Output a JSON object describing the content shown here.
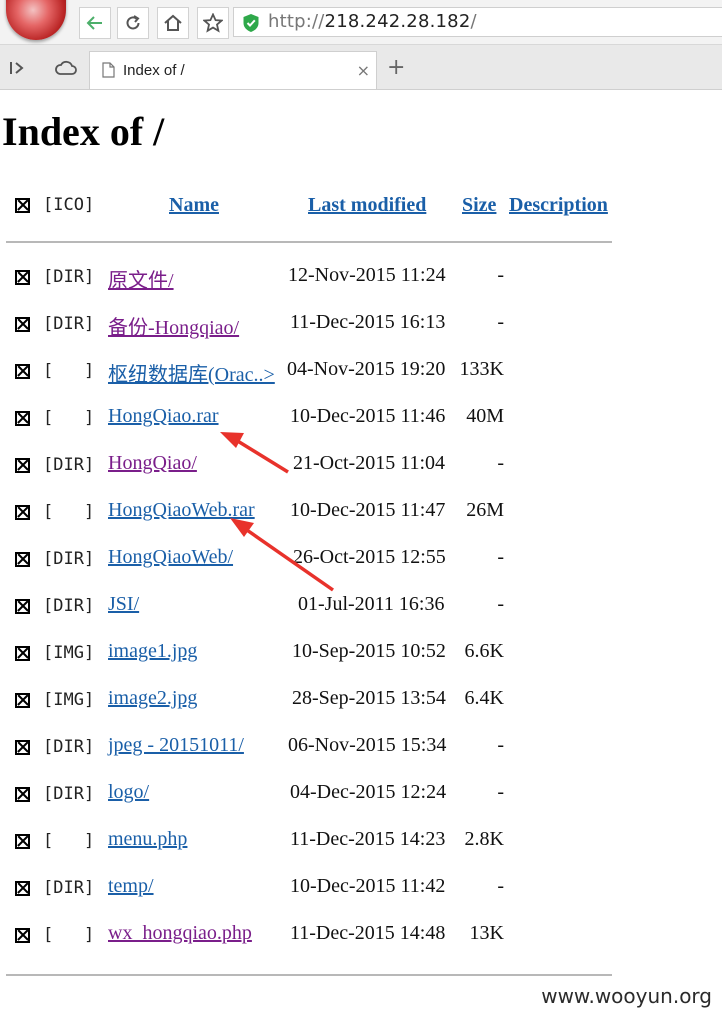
{
  "browser": {
    "url_scheme": "http://",
    "url_host": "218.242.28.182",
    "url_path": "/",
    "tab_title": "Index of /",
    "tab_close": "×",
    "new_tab": "+"
  },
  "page": {
    "title": "Index of /",
    "header_alt": "[ICO]",
    "columns": {
      "name": "Name",
      "last_modified": "Last modified",
      "size": "Size",
      "description": "Description"
    },
    "rows": [
      {
        "alt": "[DIR]",
        "name": "原文件/",
        "date": "12-Nov-2015 11:24",
        "size": "-",
        "visited": true
      },
      {
        "alt": "[DIR]",
        "name": "备份-Hongqiao/",
        "date": "11-Dec-2015 16:13",
        "size": "-",
        "visited": true
      },
      {
        "alt": "[   ]",
        "name": "枢纽数据库(Orac..>",
        "date": "04-Nov-2015 19:20",
        "size": "133K",
        "visited": false
      },
      {
        "alt": "[   ]",
        "name": "HongQiao.rar",
        "date": "10-Dec-2015 11:46",
        "size": "40M",
        "visited": false
      },
      {
        "alt": "[DIR]",
        "name": "HongQiao/",
        "date": "21-Oct-2015 11:04",
        "size": "-",
        "visited": true
      },
      {
        "alt": "[   ]",
        "name": "HongQiaoWeb.rar",
        "date": "10-Dec-2015 11:47",
        "size": "26M",
        "visited": false
      },
      {
        "alt": "[DIR]",
        "name": "HongQiaoWeb/",
        "date": "26-Oct-2015 12:55",
        "size": "-",
        "visited": false
      },
      {
        "alt": "[DIR]",
        "name": "JSI/",
        "date": "01-Jul-2011 16:36",
        "size": "-",
        "visited": false
      },
      {
        "alt": "[IMG]",
        "name": "image1.jpg",
        "date": "10-Sep-2015 10:52",
        "size": "6.6K",
        "visited": false
      },
      {
        "alt": "[IMG]",
        "name": "image2.jpg",
        "date": "28-Sep-2015 13:54",
        "size": "6.4K",
        "visited": false
      },
      {
        "alt": "[DIR]",
        "name": "jpeg - 20151011/",
        "date": "06-Nov-2015 15:34",
        "size": "-",
        "visited": false
      },
      {
        "alt": "[DIR]",
        "name": "logo/",
        "date": "04-Dec-2015 12:24",
        "size": "-",
        "visited": false
      },
      {
        "alt": "[   ]",
        "name": "menu.php",
        "date": "11-Dec-2015 14:23",
        "size": "2.8K",
        "visited": false
      },
      {
        "alt": "[DIR]",
        "name": "temp/",
        "date": "10-Dec-2015 11:42",
        "size": "-",
        "visited": false
      },
      {
        "alt": "[   ]",
        "name": "wx_hongqiao.php",
        "date": "11-Dec-2015 14:48",
        "size": "13K",
        "visited": true
      }
    ]
  },
  "watermark": "www.wooyun.org",
  "colors": {
    "link": "#1a5fa8",
    "visited": "#7a1e8a",
    "annotation_arrow": "#e8322b",
    "secure_shield": "#2ea84a"
  },
  "icons": [
    "back-arrow-icon",
    "reload-icon",
    "home-icon",
    "star-icon",
    "shield-icon",
    "sidebar-toggle-icon",
    "cloud-icon",
    "page-icon",
    "close-icon",
    "plus-icon",
    "broken-image-icon"
  ]
}
